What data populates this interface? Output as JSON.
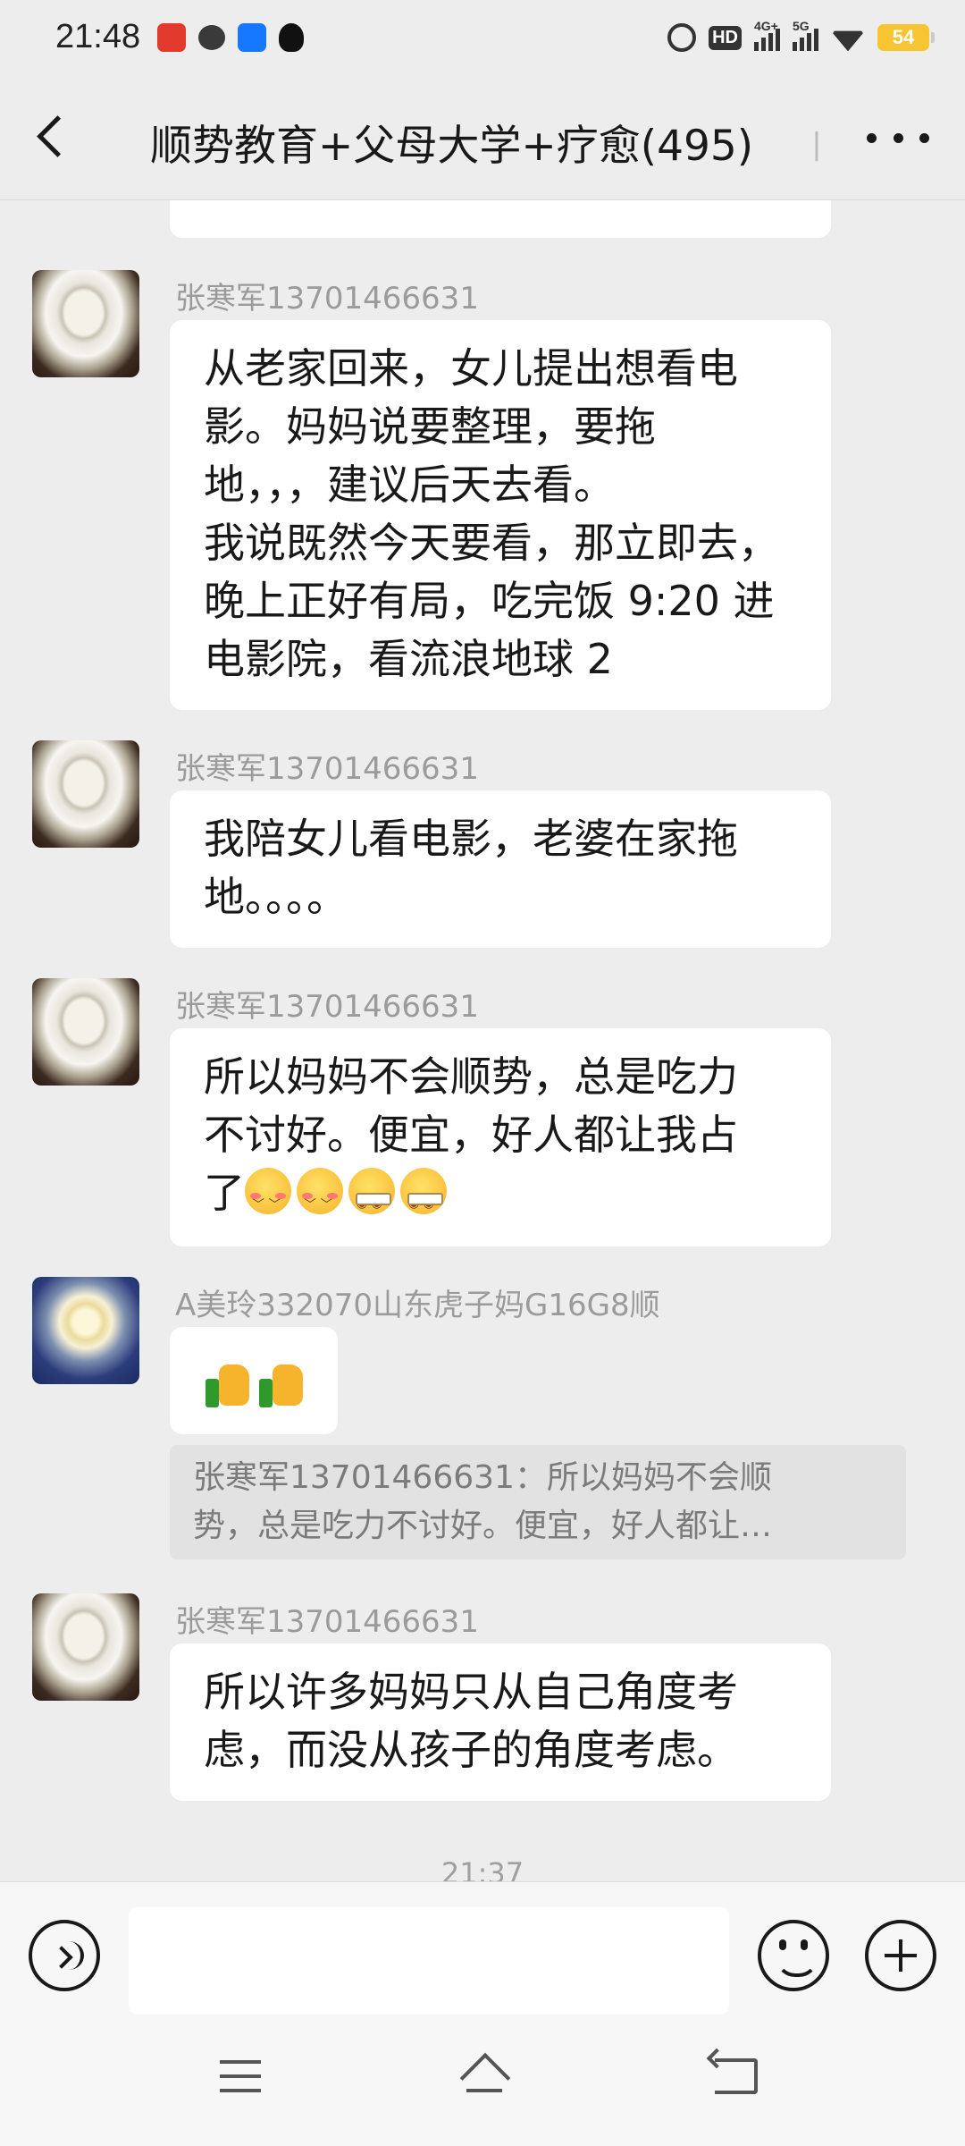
{
  "status_bar": {
    "time": "21:48",
    "network_hd": "HD",
    "network_4g": "4G+",
    "network_5g": "5G",
    "battery": "54",
    "icons": [
      "app-notification-icon",
      "chat-bubble-icon",
      "alipay-icon",
      "qq-icon",
      "alarm-icon",
      "hd-icon",
      "signal-icon",
      "wifi-icon",
      "battery-icon"
    ]
  },
  "header": {
    "title": "顺势教育+父母大学+疗愈(495)",
    "title_overflow": "丨",
    "back_icon": "chevron-left-icon",
    "more_icon": "more-dots-icon"
  },
  "messages": [
    {
      "sender": "张寒军13701466631",
      "avatar": "teacup-avatar",
      "lines": [
        "从老家回来，女儿提出想看电",
        "影。妈妈说要整理，要拖",
        "地，，，建议后天去看。",
        "我说既然今天要看，那立即去，",
        "晚上正好有局，吃完饭 9:20 进",
        "电影院，看流浪地球 2"
      ]
    },
    {
      "sender": "张寒军13701466631",
      "avatar": "teacup-avatar",
      "lines": [
        "我陪女儿看电影，老婆在家拖",
        "地。。。。"
      ]
    },
    {
      "sender": "张寒军13701466631",
      "avatar": "teacup-avatar",
      "lines": [
        "所以妈妈不会顺势，总是吃力",
        "不讨好。便宜，好人都让我占",
        "了"
      ],
      "emojis": [
        "blush-face",
        "blush-face",
        "zipper-mouth-face",
        "zipper-mouth-face"
      ]
    },
    {
      "sender": "A美玲332070山东虎子妈G16G8顺",
      "avatar": "flower-avatar",
      "emojis": [
        "thumbs-up",
        "thumbs-up"
      ],
      "quote_lines": [
        "张寒军13701466631：所以妈妈不会顺",
        "势，总是吃力不讨好。便宜，好人都让…"
      ]
    },
    {
      "sender": "张寒军13701466631",
      "avatar": "teacup-avatar",
      "lines": [
        "所以许多妈妈只从自己角度考",
        "虑，而没从孩子的角度考虑。"
      ]
    }
  ],
  "timestamp": "21:37",
  "input": {
    "value": "",
    "placeholder": ""
  },
  "colors": {
    "background": "#ededed",
    "bubble": "#ffffff",
    "sender_text": "#9b9b9b",
    "quote_bg": "#e2e2e2",
    "battery": "#f7c531"
  }
}
